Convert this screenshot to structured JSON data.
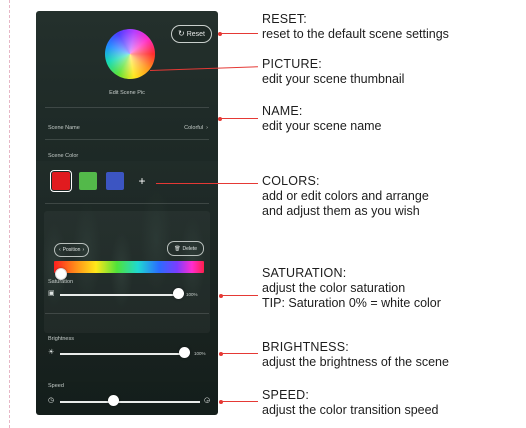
{
  "phone": {
    "reset_label": "Reset",
    "reset_icon": "refresh-icon",
    "edit_pic_label": "Edit Scene Pic",
    "scene_name_label": "Scene Name",
    "scene_name_value": "Colorful",
    "scene_color_label": "Scene Color",
    "add_symbol": "+",
    "position_label": "Position",
    "delete_label": "Delete",
    "saturation_label": "Saturation",
    "saturation_value": "100%",
    "saturation_level": 1.0,
    "brightness_label": "Brightness",
    "brightness_value": "100%",
    "brightness_level": 1.0,
    "speed_label": "Speed",
    "speed_level": 0.38,
    "colors": [
      "#e11b1f",
      "#53b94a",
      "#3c55c2"
    ]
  },
  "annotations": {
    "reset_title": "RESET:",
    "reset_desc": "reset to the default scene settings",
    "picture_title": "PICTURE:",
    "picture_desc": "edit your scene thumbnail",
    "name_title": "NAME:",
    "name_desc": "edit your scene name",
    "colors_title": "COLORS:",
    "colors_desc_1": "add or edit colors and arrange",
    "colors_desc_2": "and adjust them as you wish",
    "saturation_title": "SATURATION:",
    "saturation_desc": "adjust the color saturation",
    "saturation_tip": "TIP:  Saturation 0% = white color",
    "brightness_title": "BRIGHTNESS:",
    "brightness_desc": "adjust the brightness of the scene",
    "speed_title": "SPEED:",
    "speed_desc": "adjust the color transition speed"
  },
  "accent_color": "#e53935"
}
